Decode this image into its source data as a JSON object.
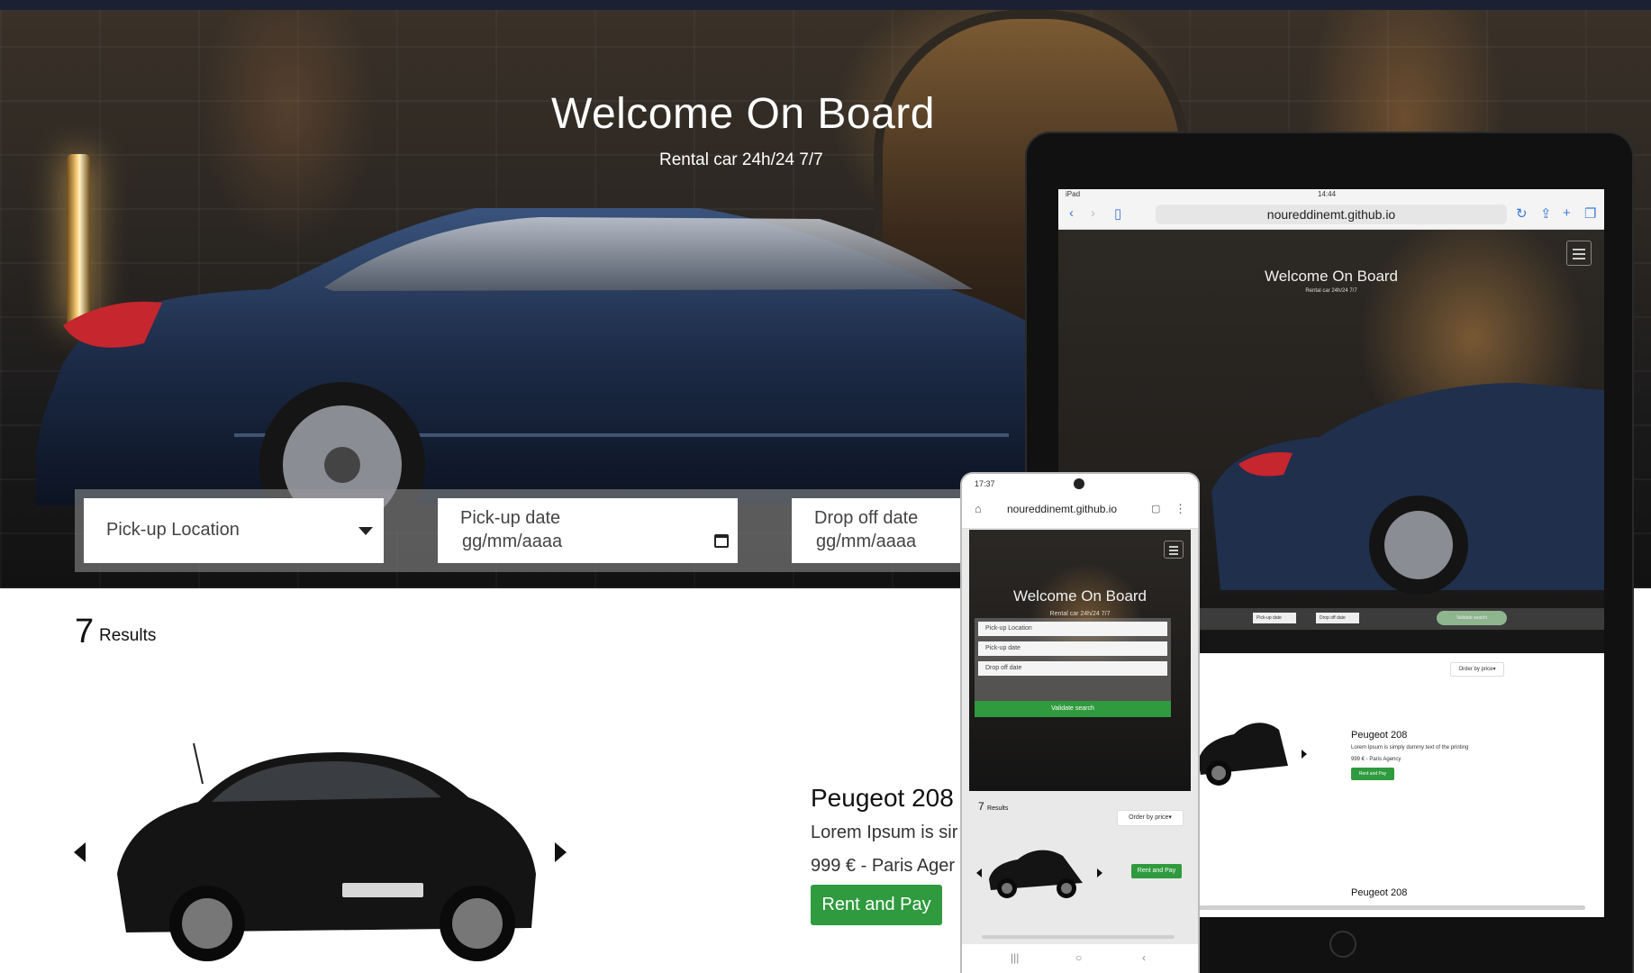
{
  "hero": {
    "title": "Welcome On Board",
    "subtitle": "Rental car 24h/24 7/7"
  },
  "search": {
    "pickup_location": "Pick-up Location",
    "pickup_date_label": "Pick-up date",
    "pickup_date_value": "gg/mm/aaaa",
    "dropoff_date_label": "Drop off date",
    "dropoff_date_value": "gg/mm/aaaa"
  },
  "results": {
    "count": "7",
    "label": "Results"
  },
  "car": {
    "name": "Peugeot 208",
    "description": "Lorem Ipsum is sir",
    "price": "999 € - Paris Ager",
    "button": "Rent and Pay"
  },
  "tablet": {
    "status_left": "iPad",
    "status_time": "14:44",
    "url": "noureddinemt.github.io",
    "title": "Welcome On Board",
    "subtitle": "Rental car 24h/24 7/7",
    "pickup_date": "Pick-up date",
    "dropoff_date": "Drop off date",
    "validate": "Validate search",
    "order": "Order by price▾",
    "car_name": "Peugeot 208",
    "car_desc": "Lorem Ipsum is simply dummy text of the printing",
    "car_price": "999 € - Paris Agency",
    "button": "Rent and Pay",
    "car_name_2": "Peugeot 208"
  },
  "phone": {
    "status_time": "17:37",
    "url": "noureddinemt.github.io",
    "title": "Welcome On Board",
    "subtitle": "Rental car 24h/24 7/7",
    "pickup_location": "Pick-up Location",
    "pickup_date": "Pick-up date",
    "dropoff_date": "Drop off date",
    "validate": "Validate search",
    "results_count": "7",
    "results_label": "Results",
    "order": "Order by price▾",
    "button": "Rent and Pay"
  },
  "colors": {
    "accent_green": "#2f9a3e",
    "topbar": "#1c2033"
  }
}
